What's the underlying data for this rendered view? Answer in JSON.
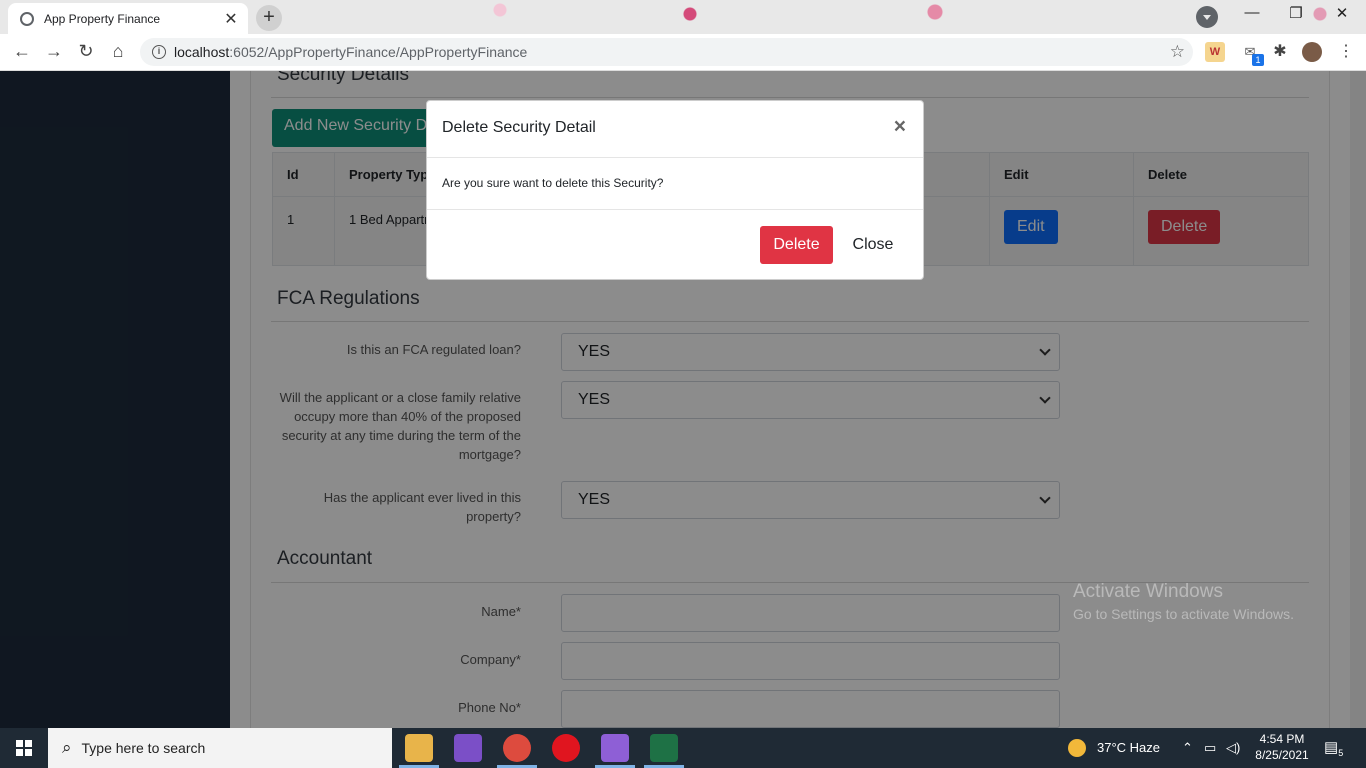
{
  "browser": {
    "tab_title": "App Property Finance",
    "tab_close": "✕",
    "new_tab": "+",
    "url_host": "localhost",
    "url_path": ":6052/AppPropertyFinance/AppPropertyFinance",
    "mail_badge": "1"
  },
  "security": {
    "title": "Security Details",
    "add_button": "Add New Security Detail",
    "columns": [
      "Id",
      "Property Type",
      "Edit",
      "Delete"
    ],
    "rows": [
      {
        "id": "1",
        "property_type": "1 Bed Appartment",
        "edit": "Edit",
        "delete": "Delete"
      }
    ]
  },
  "fca": {
    "title": "FCA Regulations",
    "q1_label": "Is this an FCA regulated loan?",
    "q1_value": "YES",
    "q2_label": "Will the applicant or a close family relative occupy more than 40% of the proposed security at any time during the term of the mortgage?",
    "q2_value": "YES",
    "q3_label": "Has the applicant ever lived in this property?",
    "q3_value": "YES"
  },
  "accountant": {
    "title": "Accountant",
    "name_label": "Name*",
    "company_label": "Company*",
    "phone_label": "Phone No*"
  },
  "watermark": {
    "line1": "Activate Windows",
    "line2": "Go to Settings to activate Windows."
  },
  "modal": {
    "title": "Delete Security Detail",
    "close_x": "×",
    "message": "Are you sure want to delete this Security?",
    "delete_label": "Delete",
    "close_label": "Close"
  },
  "taskbar": {
    "search_placeholder": "Type here to search",
    "weather": "37°C  Haze",
    "time": "4:54 PM",
    "date": "8/25/2021",
    "notification_count": "5"
  },
  "colors": {
    "sidebar": "#1e2b3c",
    "add_button": "#0e8f79",
    "edit_button": "#0d6efd",
    "delete_button": "#dc3545"
  }
}
